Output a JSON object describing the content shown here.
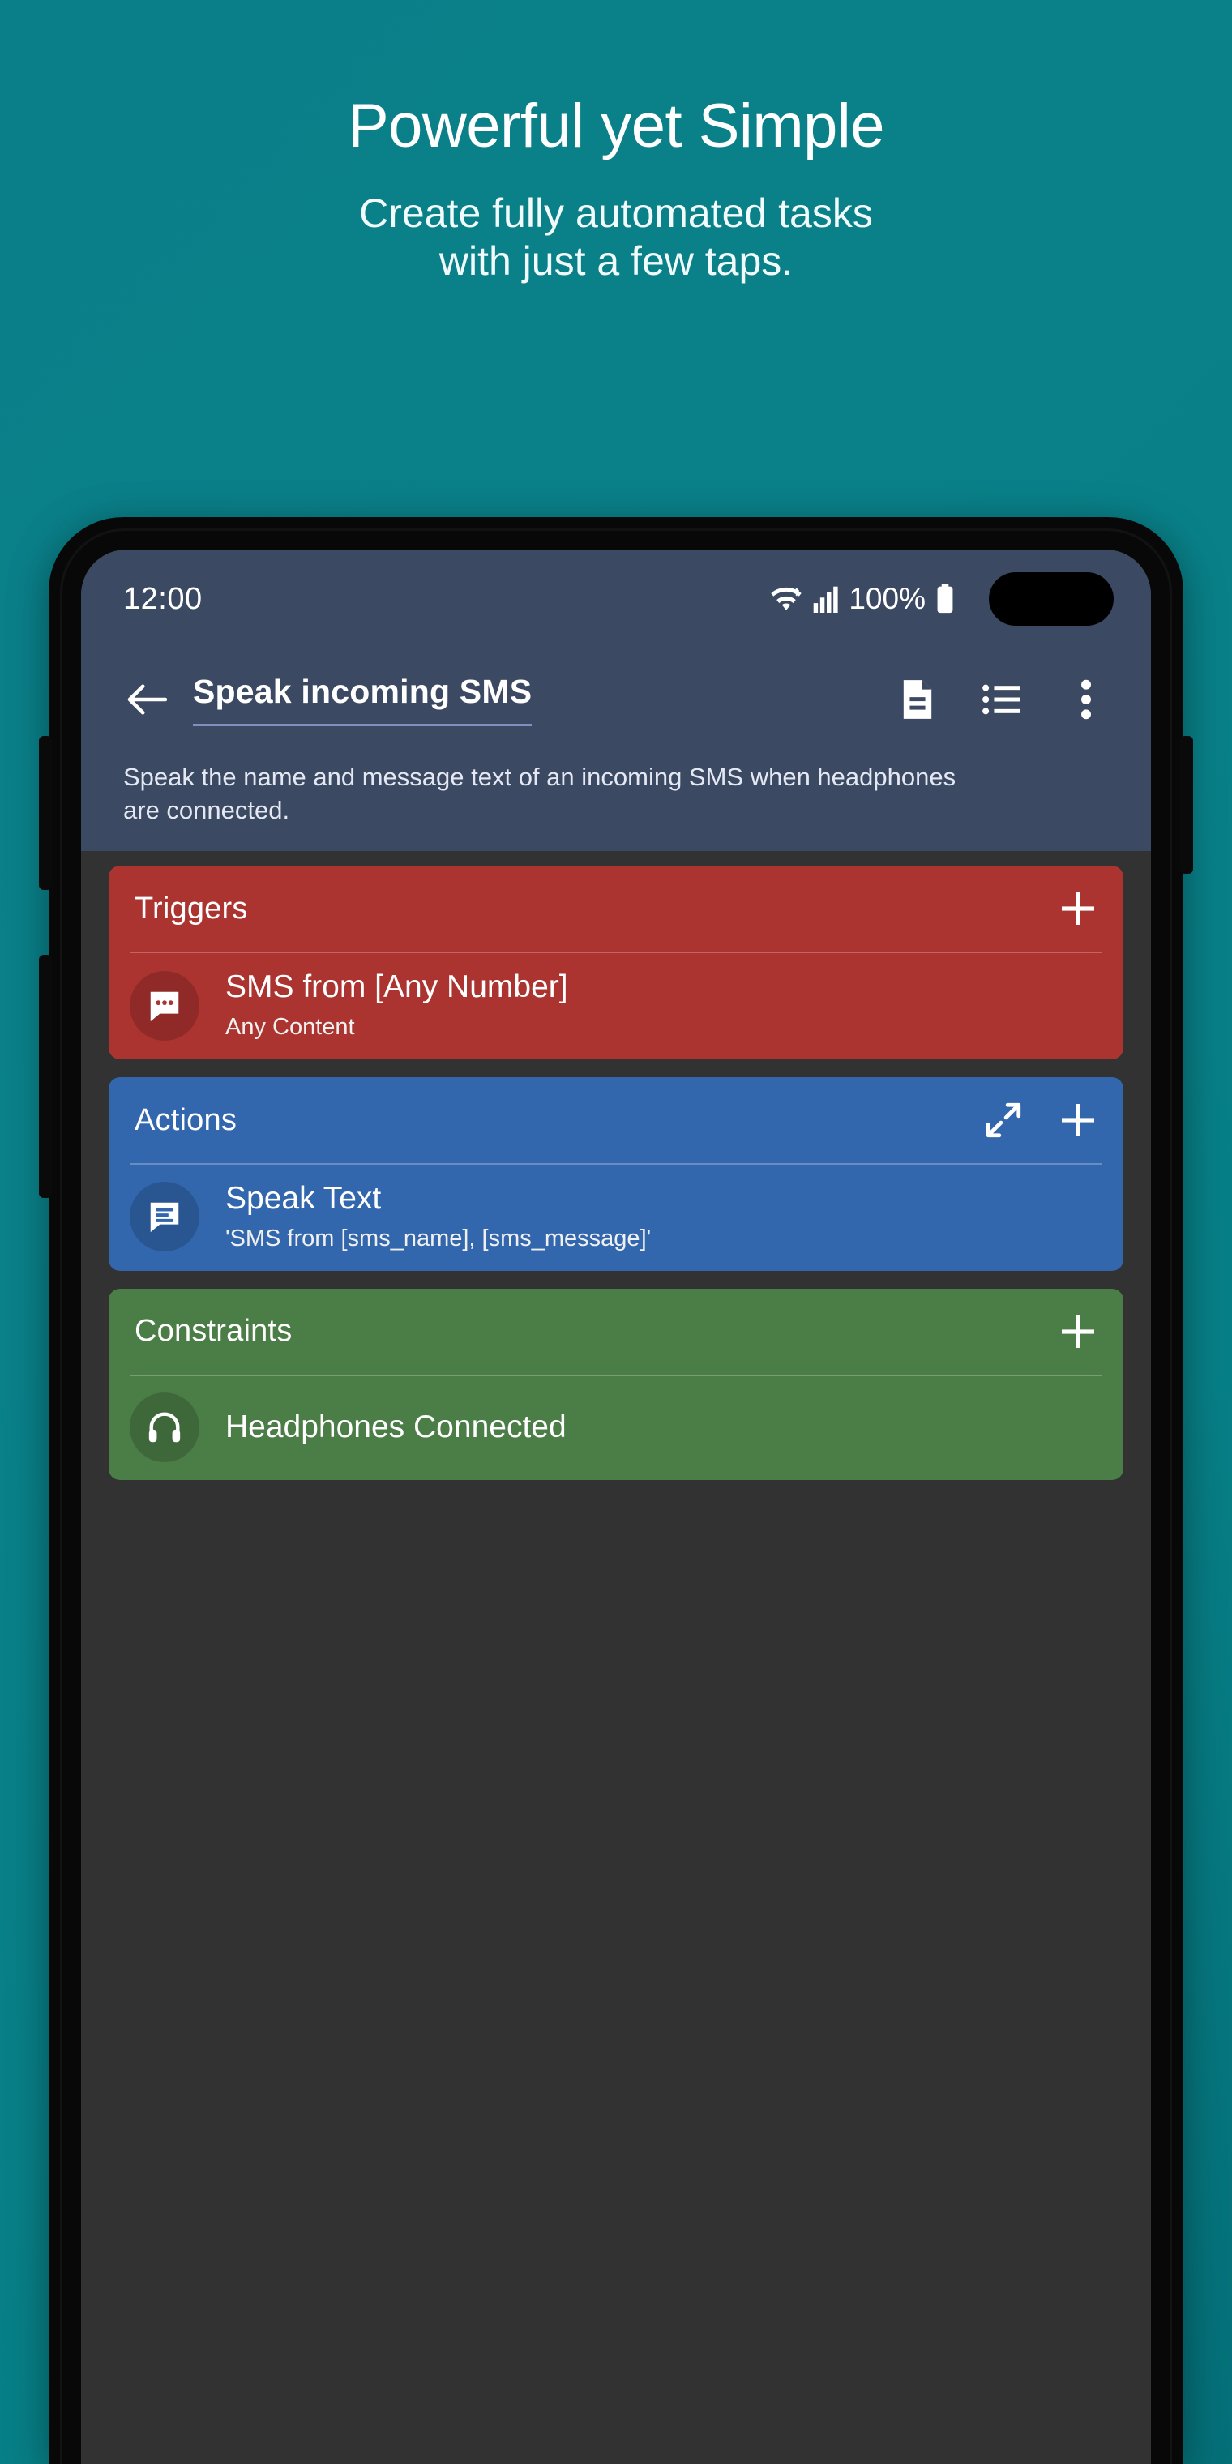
{
  "promo": {
    "title": "Powerful yet Simple",
    "subtitle_line1": "Create fully automated tasks",
    "subtitle_line2": "with just a few taps."
  },
  "phone": {
    "status_bar": {
      "time": "12:00",
      "wifi_icon": "wifi-icon",
      "signal_icon": "cellular-signal-icon",
      "battery_percent": "100%",
      "battery_icon": "battery-full-icon",
      "camera_cutout": "front-camera-cutout"
    },
    "app_bar": {
      "back_icon": "arrow-left-icon",
      "title": "Speak incoming SMS",
      "description": "Speak the name and message text of an incoming SMS when headphones are connected.",
      "actions": [
        {
          "name": "notes-icon",
          "label": "Notes"
        },
        {
          "name": "list-icon",
          "label": "Task list"
        },
        {
          "name": "overflow-menu-icon",
          "label": "More options"
        }
      ]
    },
    "cards": [
      {
        "id": "triggers",
        "title": "Triggers",
        "color": "#ab3330",
        "head_icons": [
          {
            "name": "plus-icon",
            "label": "Add trigger"
          }
        ],
        "rows": [
          {
            "icon": "sms-message-icon",
            "title": "SMS from [Any Number]",
            "subtitle": "Any Content"
          }
        ]
      },
      {
        "id": "actions",
        "title": "Actions",
        "color": "#3266ad",
        "head_icons": [
          {
            "name": "expand-diagonal-icon",
            "label": "Expand"
          },
          {
            "name": "plus-icon",
            "label": "Add action"
          }
        ],
        "rows": [
          {
            "icon": "speak-text-icon",
            "title": "Speak Text",
            "subtitle": "'SMS from [sms_name], [sms_message]'"
          }
        ]
      },
      {
        "id": "constraints",
        "title": "Constraints",
        "color": "#4b7d46",
        "head_icons": [
          {
            "name": "plus-icon",
            "label": "Add constraint"
          }
        ],
        "rows": [
          {
            "icon": "headphones-icon",
            "title": "Headphones Connected",
            "subtitle": ""
          }
        ]
      }
    ]
  },
  "colors": {
    "background_teal": "#0a8089",
    "app_bar_navy": "#3c4963",
    "screen_body": "#323232",
    "triggers_red": "#ab3330",
    "actions_blue": "#3266ad",
    "constraints_green": "#4b7d46",
    "title_underline": "#7f8fc0"
  }
}
